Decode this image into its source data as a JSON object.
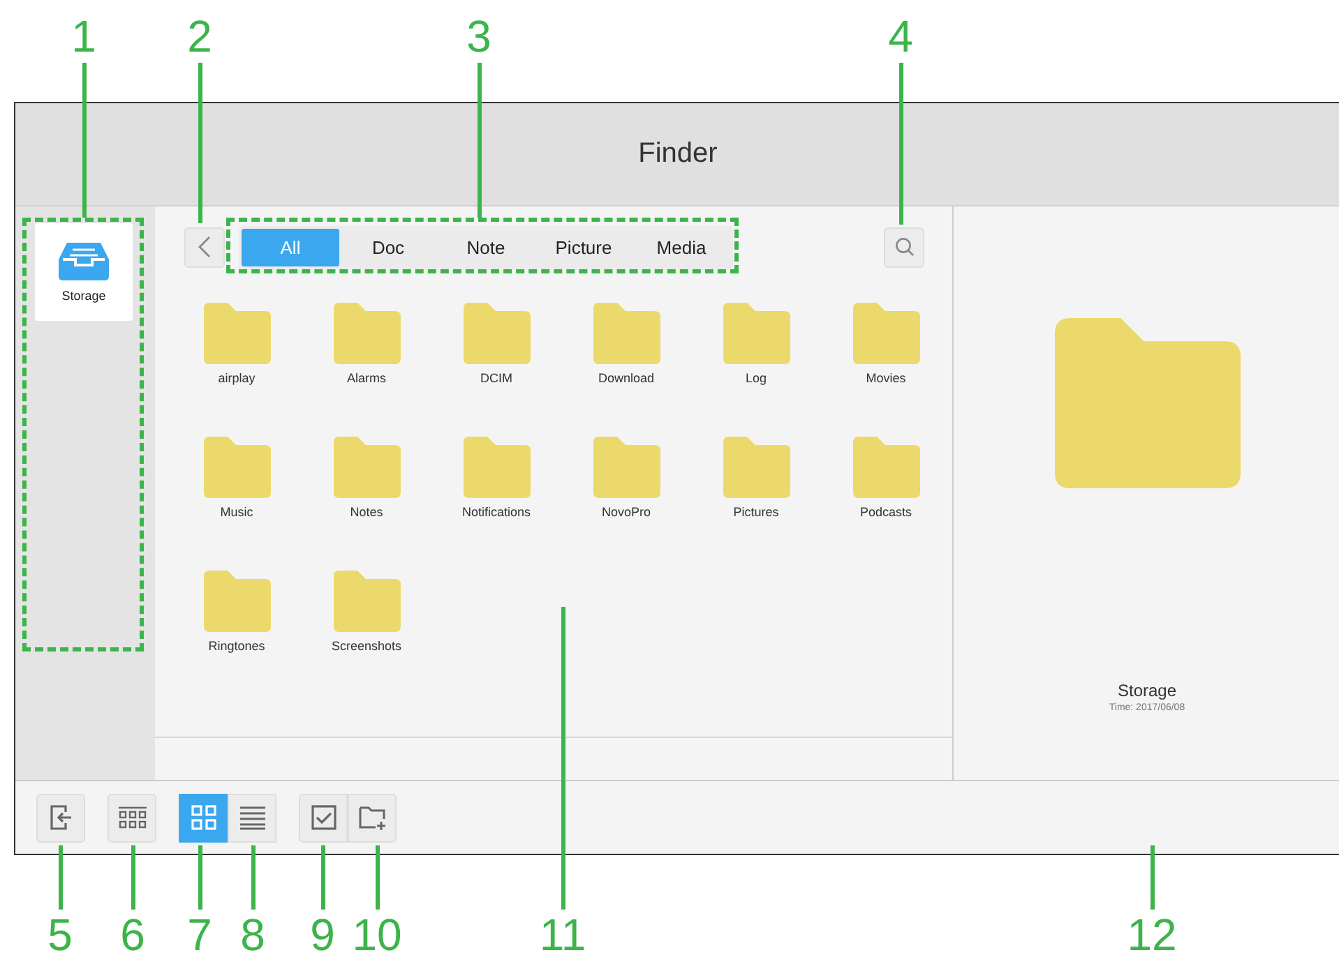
{
  "callouts": [
    {
      "number": "1"
    },
    {
      "number": "2"
    },
    {
      "number": "3"
    },
    {
      "number": "4"
    },
    {
      "number": "5"
    },
    {
      "number": "6"
    },
    {
      "number": "7"
    },
    {
      "number": "8"
    },
    {
      "number": "9"
    },
    {
      "number": "10"
    },
    {
      "number": "11"
    },
    {
      "number": "12"
    }
  ],
  "window": {
    "title": "Finder"
  },
  "sidebar": {
    "items": [
      {
        "label": "Storage",
        "selected": true
      }
    ]
  },
  "filter_tabs": [
    {
      "label": "All",
      "selected": true
    },
    {
      "label": "Doc",
      "selected": false
    },
    {
      "label": "Note",
      "selected": false
    },
    {
      "label": "Picture",
      "selected": false
    },
    {
      "label": "Media",
      "selected": false
    }
  ],
  "folders": [
    {
      "name": "airplay"
    },
    {
      "name": "Alarms"
    },
    {
      "name": "DCIM"
    },
    {
      "name": "Download"
    },
    {
      "name": "Log"
    },
    {
      "name": "Movies"
    },
    {
      "name": "Music"
    },
    {
      "name": "Notes"
    },
    {
      "name": "Notifications"
    },
    {
      "name": "NovoPro"
    },
    {
      "name": "Pictures"
    },
    {
      "name": "Podcasts"
    },
    {
      "name": "Ringtones"
    },
    {
      "name": "Screenshots"
    }
  ],
  "details": {
    "name": "Storage",
    "time": "Time: 2017/06/08"
  },
  "view_modes": [
    {
      "kind": "grid",
      "selected": true
    },
    {
      "kind": "list",
      "selected": false
    }
  ]
}
